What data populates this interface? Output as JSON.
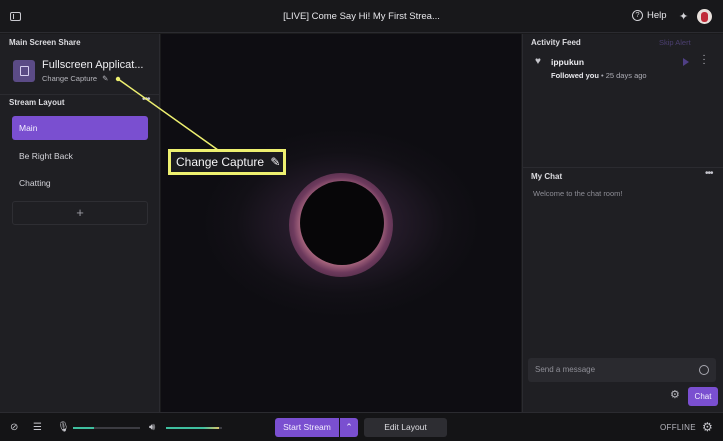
{
  "window": {
    "title": "[LIVE] Come Say Hi! My First Strea...",
    "help_label": "Help",
    "sidebar_toggle_icon": "sidebar-toggle-icon",
    "sparkle_icon": "sparkle-icon"
  },
  "left_panel": {
    "screen_share_heading": "Main Screen Share",
    "capture_title": "Fullscreen Applicat...",
    "change_capture_label": "Change Capture",
    "stream_layout_heading": "Stream Layout",
    "layouts": [
      {
        "label": "Main",
        "active": true
      },
      {
        "label": "Be Right Back",
        "active": false
      },
      {
        "label": "Chatting",
        "active": false
      }
    ],
    "add_layout_symbol": "+"
  },
  "callout": {
    "label": "Change Capture",
    "border_color": "#eef070"
  },
  "right_panel": {
    "activity_heading": "Activity Feed",
    "skip_alert_label": "Skip Alert",
    "feed_item": {
      "username": "ippukun",
      "action": "Followed you",
      "time": " • 25 days ago"
    },
    "chat_heading": "My Chat",
    "chat_welcome": "Welcome to the chat room!",
    "chat_placeholder": "Send a message",
    "chat_button_label": "Chat"
  },
  "bottom_bar": {
    "mic_level": 0.32,
    "volume_level": 0.95,
    "start_stream_label": "Start Stream",
    "edit_layout_label": "Edit Layout",
    "status_label": "OFFLINE"
  },
  "colors": {
    "accent": "#7a4fd0",
    "background": "#1f1f23",
    "slider_fill": "#3fbf9f"
  }
}
